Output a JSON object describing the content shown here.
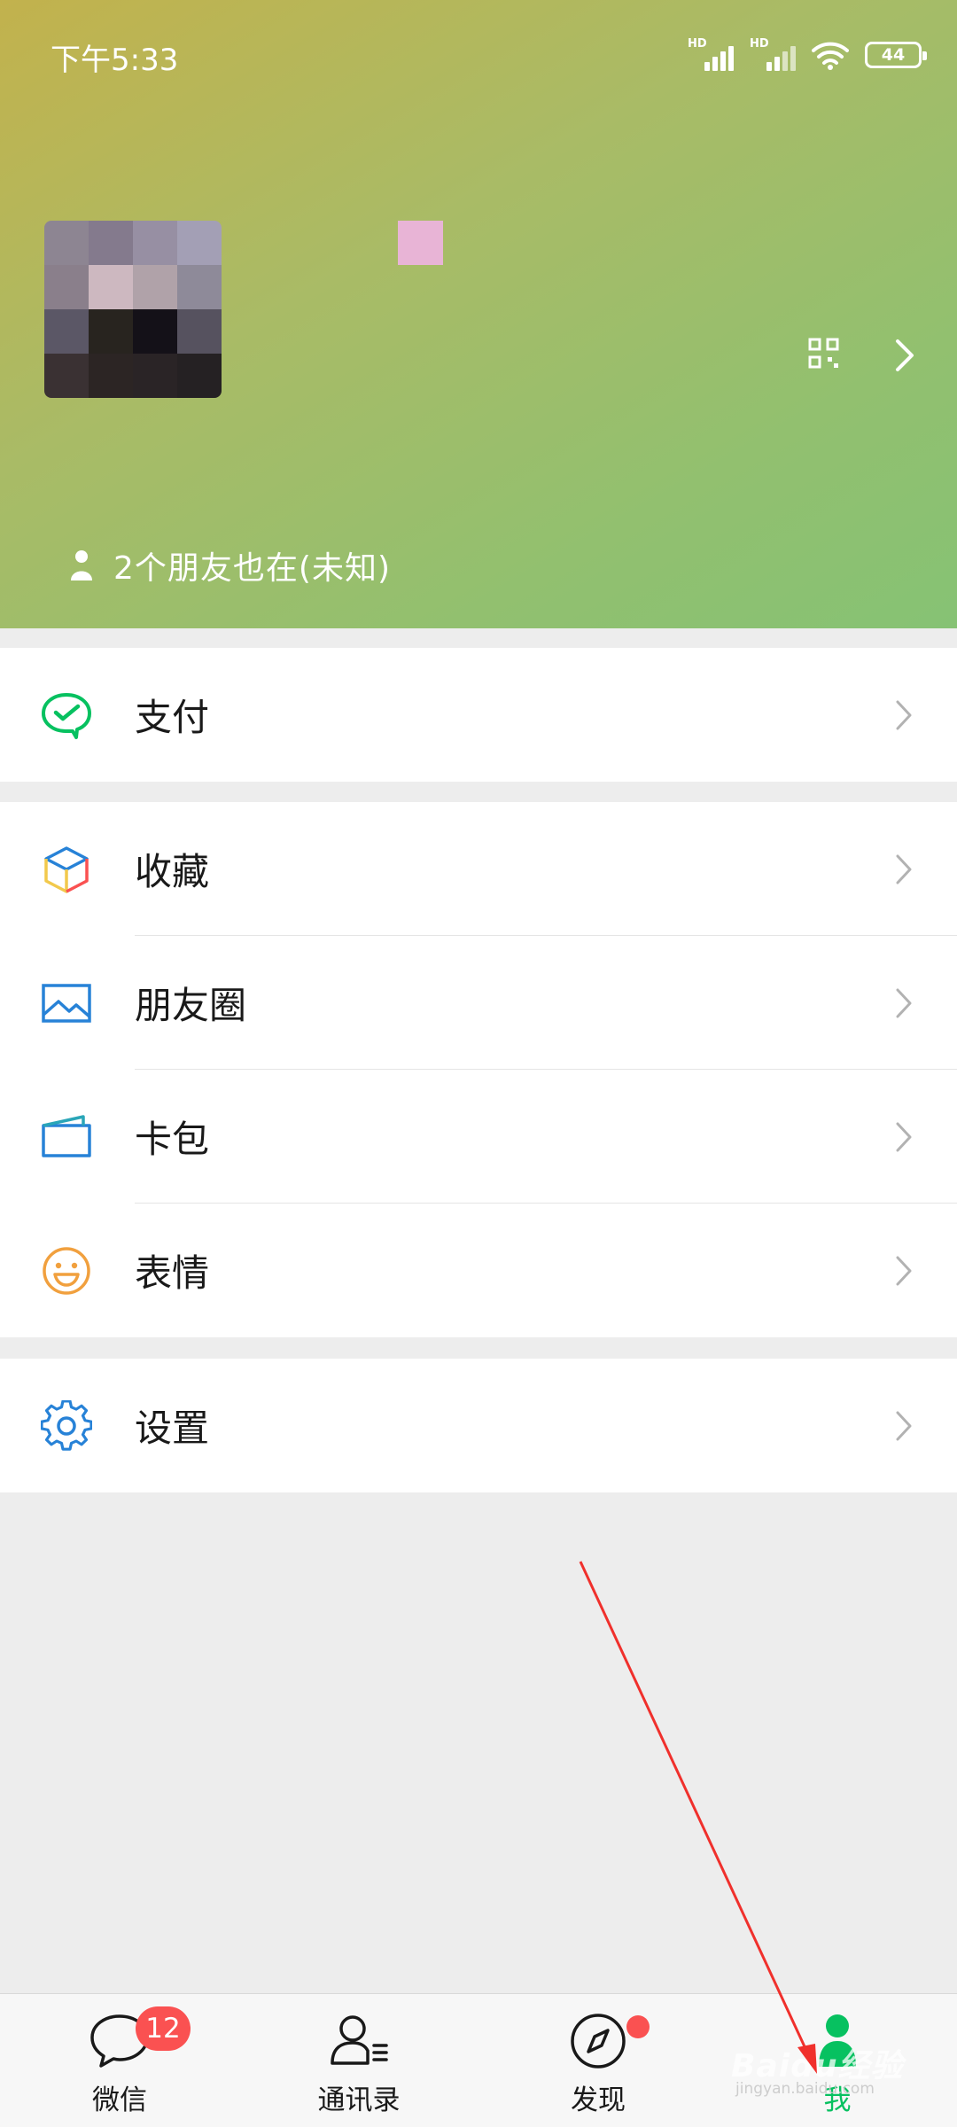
{
  "status_bar": {
    "time": "下午5:33",
    "hd_label": "HD",
    "battery": "44"
  },
  "profile": {
    "friends_text": "2个朋友也在(未知)"
  },
  "menu_groups": [
    [
      {
        "label": "支付",
        "icon": "wechat-pay-icon",
        "color": "#07c160"
      }
    ],
    [
      {
        "label": "收藏",
        "icon": "favorites-cube-icon"
      },
      {
        "label": "朋友圈",
        "icon": "moments-picture-icon",
        "color": "#2782d7"
      },
      {
        "label": "卡包",
        "icon": "card-wallet-icon",
        "color": "#2782d7"
      },
      {
        "label": "表情",
        "icon": "sticker-smiley-icon",
        "color": "#f1a03e"
      }
    ],
    [
      {
        "label": "设置",
        "icon": "settings-gear-icon",
        "color": "#2782d7"
      }
    ]
  ],
  "tabbar": {
    "tabs": [
      {
        "label": "微信",
        "icon": "chat-bubble-icon",
        "badge": "12"
      },
      {
        "label": "通讯录",
        "icon": "contacts-icon"
      },
      {
        "label": "发现",
        "icon": "compass-icon",
        "dot": true
      },
      {
        "label": "我",
        "icon": "me-person-icon",
        "active": true
      }
    ],
    "active_color": "#07c160"
  },
  "watermark": {
    "brand": "Baidu经验",
    "url": "jingyan.baidu.com"
  }
}
